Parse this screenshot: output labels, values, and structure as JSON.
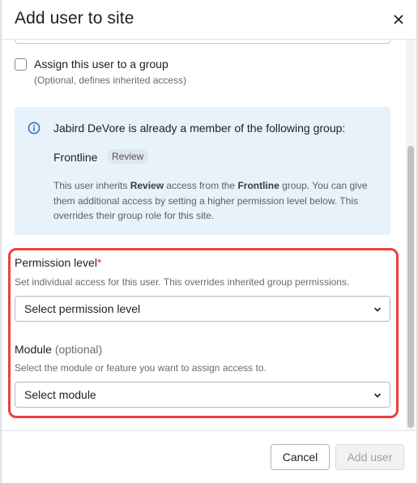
{
  "dialog": {
    "title": "Add user to site"
  },
  "group_assignment": {
    "checkbox_label": "Assign this user to a group",
    "help_text": "(Optional, defines inherited access)",
    "checked": false
  },
  "info_notice": {
    "heading": "Jabird DeVore is already a member of the following group:",
    "group_name": "Frontline",
    "group_role": "Review",
    "desc_1": "This user inherits ",
    "desc_role": "Review",
    "desc_2": " access from the ",
    "desc_group": "Frontline",
    "desc_3": " group. You can give them additional access by setting a higher permission level below. This overrides their group role for this site."
  },
  "permission_level": {
    "label": "Permission level",
    "required_mark": "*",
    "help_text": "Set individual access for this user. This overrides inherited group permissions.",
    "value": "Select permission level"
  },
  "module": {
    "label": "Module",
    "optional_text": "(optional)",
    "help_text": "Select the module or feature you want to assign access to.",
    "value": "Select module"
  },
  "footer": {
    "cancel_label": "Cancel",
    "add_label": "Add user"
  },
  "colors": {
    "info_background": "#e8f2fb",
    "info_icon": "#2f6fb1",
    "highlight_border": "#ef3e3e",
    "required": "#d93030"
  },
  "icons": {
    "close": "close-icon",
    "info": "info-icon",
    "select_chevron": "chevron-down-icon"
  }
}
